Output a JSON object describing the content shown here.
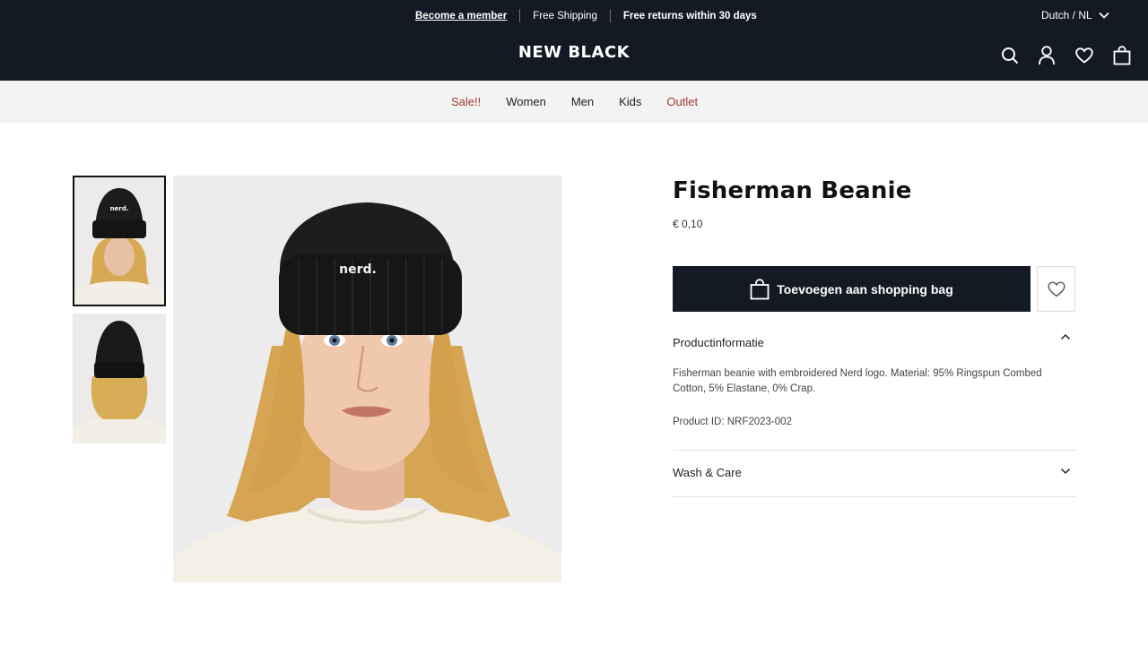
{
  "promo": {
    "member_link": "Become a member",
    "shipping": "Free Shipping",
    "returns": "Free returns within 30 days",
    "language": "Dutch / NL"
  },
  "header": {
    "logo": "NEW BLACK",
    "icons": [
      "search-icon",
      "account-icon",
      "heart-icon",
      "bag-icon"
    ]
  },
  "nav": {
    "items": [
      {
        "label": "Sale!!",
        "highlight": true
      },
      {
        "label": "Women",
        "highlight": false
      },
      {
        "label": "Men",
        "highlight": false
      },
      {
        "label": "Kids",
        "highlight": false
      },
      {
        "label": "Outlet",
        "highlight": true
      }
    ]
  },
  "gallery": {
    "thumb_1_label": "nerd.",
    "main_label": "nerd."
  },
  "product": {
    "title": "Fisherman Beanie",
    "price": "€ 0,10",
    "add_button": "Toevoegen aan shopping bag",
    "info_heading": "Productinformatie",
    "description": "Fisherman beanie with embroidered Nerd logo. Material: 95% Ringspun Combed Cotton, 5% Elastane, 0% Crap.",
    "product_id": "Product ID: NRF2023-002",
    "wash_heading": "Wash & Care"
  },
  "colors": {
    "header_bg": "#141a24",
    "nav_bg": "#f3f3f3",
    "sale_accent": "#9b3a2e"
  }
}
